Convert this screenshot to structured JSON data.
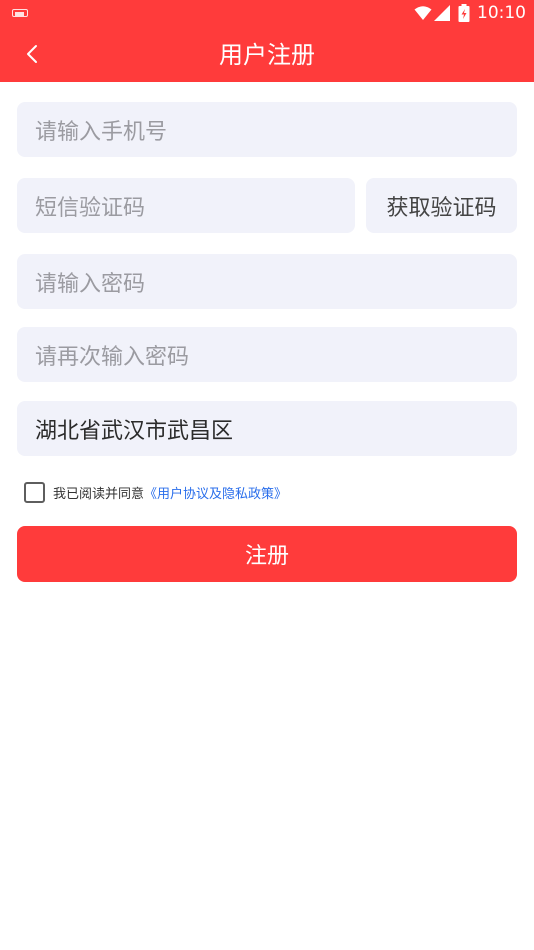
{
  "status_bar": {
    "time": "10:10",
    "icons": [
      "keyboard-icon",
      "wifi-icon",
      "signal-icon",
      "battery-icon"
    ]
  },
  "header": {
    "title": "用户注册",
    "back_icon": "chevron-left-icon",
    "background": "#FF3B3B"
  },
  "form": {
    "phone_placeholder": "请输入手机号",
    "sms_code_placeholder": "短信验证码",
    "get_code_label": "获取验证码",
    "password_placeholder": "请输入密码",
    "confirm_password_placeholder": "请再次输入密码",
    "region_value": "湖北省武汉市武昌区"
  },
  "agreement": {
    "checked": false,
    "text": "我已阅读并同意",
    "link_text": "《用户协议及隐私政策》",
    "link_color": "#2A6EEB"
  },
  "submit_label": "注册",
  "colors": {
    "accent": "#FF3B3B",
    "field_bg": "#F1F2FA",
    "placeholder": "#9B9BA1"
  }
}
